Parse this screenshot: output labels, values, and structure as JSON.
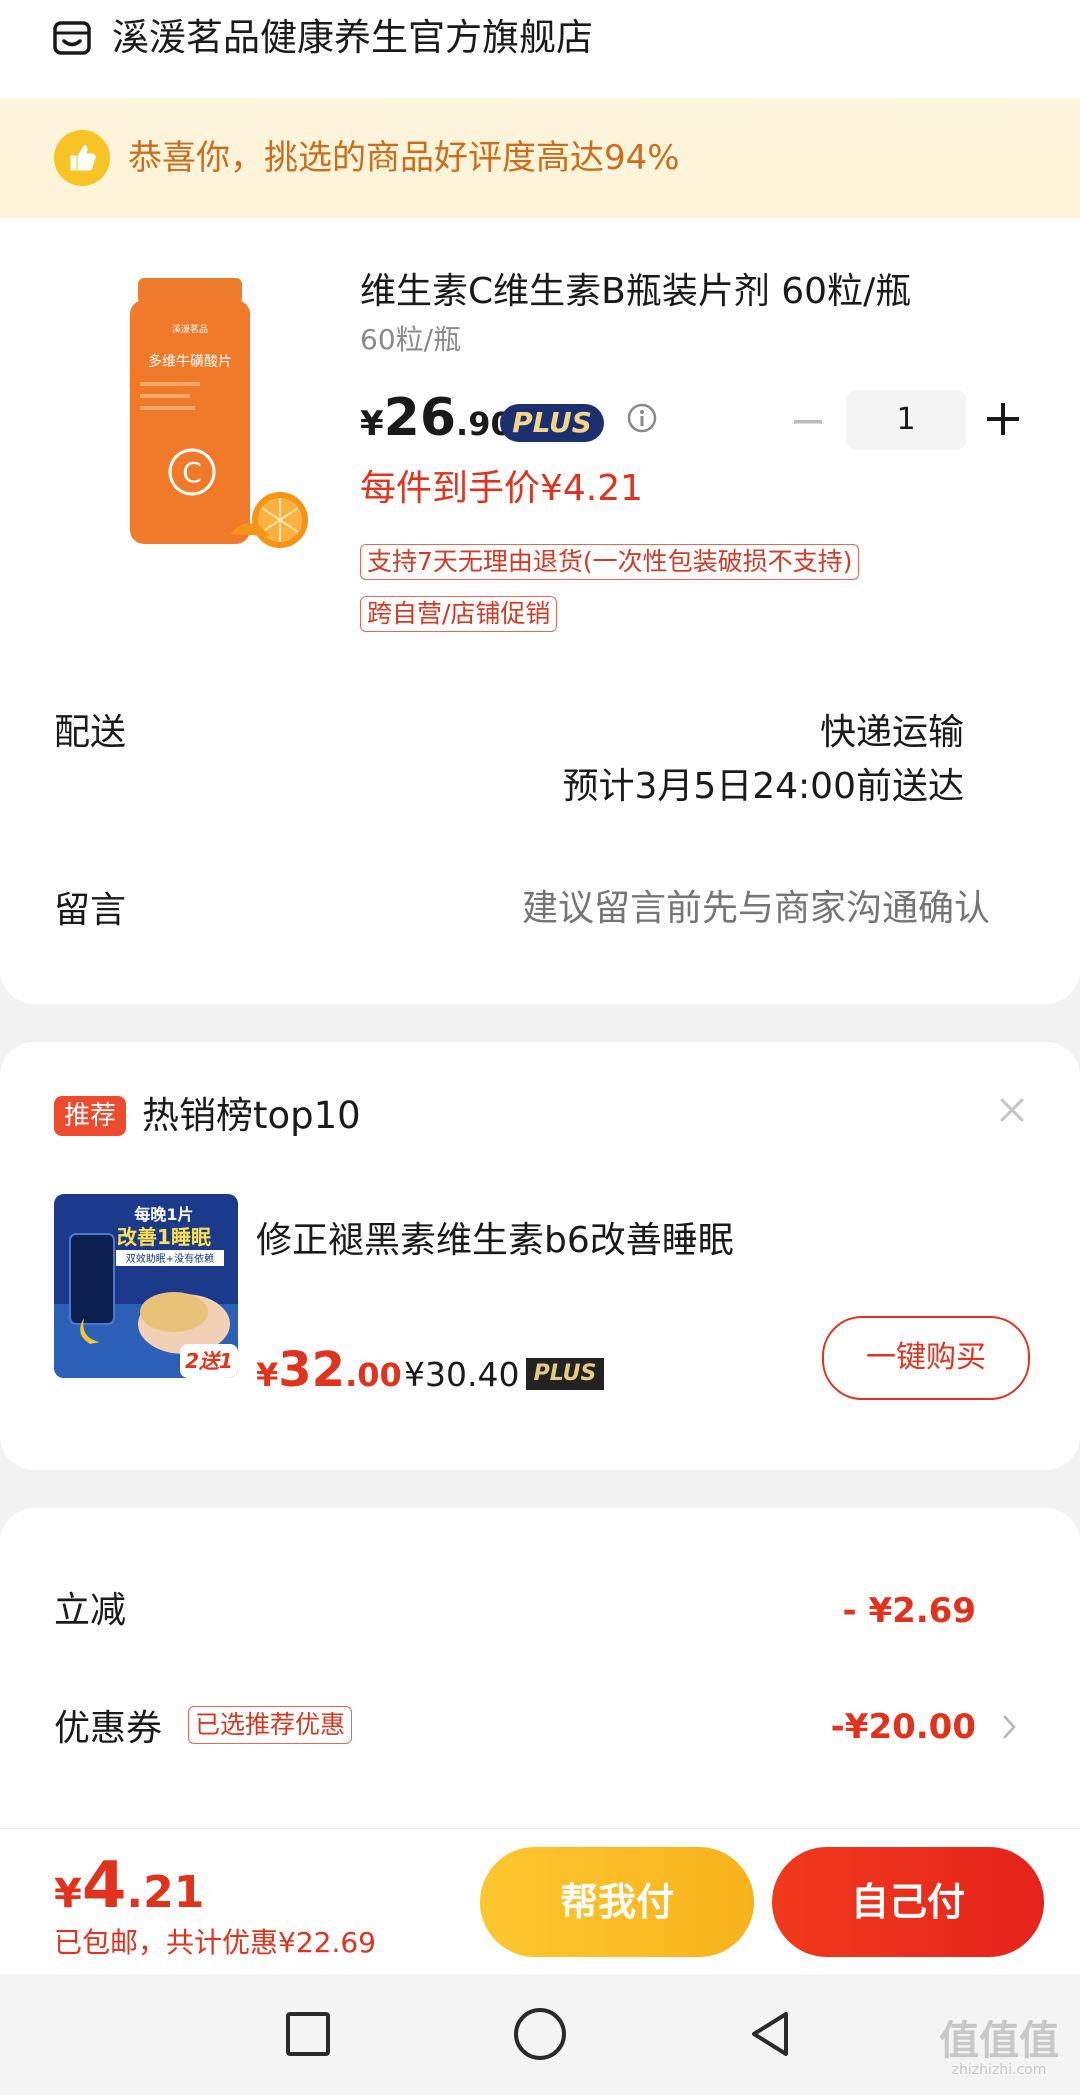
{
  "shop": {
    "name": "溪湲茗品健康养生官方旗舰店",
    "icon": "store-icon"
  },
  "banner": {
    "text": "恭喜你，挑选的商品好评度高达94%",
    "icon": "thumbs-up-icon"
  },
  "product": {
    "title": "维生素C维生素B瓶装片剂 60粒/瓶",
    "spec": "60粒/瓶",
    "price_symbol": "¥",
    "price_int": "26",
    "price_dec": ".90",
    "plus_badge": "PLUS",
    "quantity": "1",
    "hand_price": "每件到手价¥4.21",
    "tags": [
      "支持7天无理由退货(一次性包装破损不支持)",
      "跨自营/店铺促销"
    ],
    "image_text": {
      "brand": "溪湲茗品",
      "name": "多维牛磺酸片",
      "letter": "C"
    }
  },
  "shipping": {
    "label": "配送",
    "method": "快递运输",
    "eta": "预计3月5日24:00前送达"
  },
  "message": {
    "label": "留言",
    "placeholder": "建议留言前先与商家沟通确认"
  },
  "recommend": {
    "badge": "推荐",
    "title": "热销榜top10",
    "item_name": "修正褪黑素维生素b6改善睡眠",
    "price_symbol": "¥",
    "price_int": "32",
    "price_dec": ".00",
    "plus_price": "¥30.40",
    "plus_tag": "PLUS",
    "buy_label": "一键购买",
    "image_text": {
      "top": "每晚1片",
      "headline": "改善1睡眠",
      "sub": "双效助眠+没有依赖",
      "promo": "2送1"
    }
  },
  "summary": {
    "reduce_label": "立减",
    "reduce_value": "- ¥2.69",
    "coupon_label": "优惠券",
    "coupon_tag": "已选推荐优惠",
    "coupon_value": "-¥20.00"
  },
  "bottom": {
    "price_symbol": "¥",
    "price_int": "4",
    "price_dec": ".21",
    "sub_text": "已包邮，共计优惠¥22.69",
    "help_pay": "帮我付",
    "self_pay": "自己付"
  },
  "watermark": {
    "text": "值值值",
    "url": "zhizhizhi.com"
  },
  "colors": {
    "accent_red": "#e0321c",
    "banner_text": "#cc6d1d",
    "plus_navy": "#1c2f6f",
    "help_yellow": "#fdc62f"
  }
}
